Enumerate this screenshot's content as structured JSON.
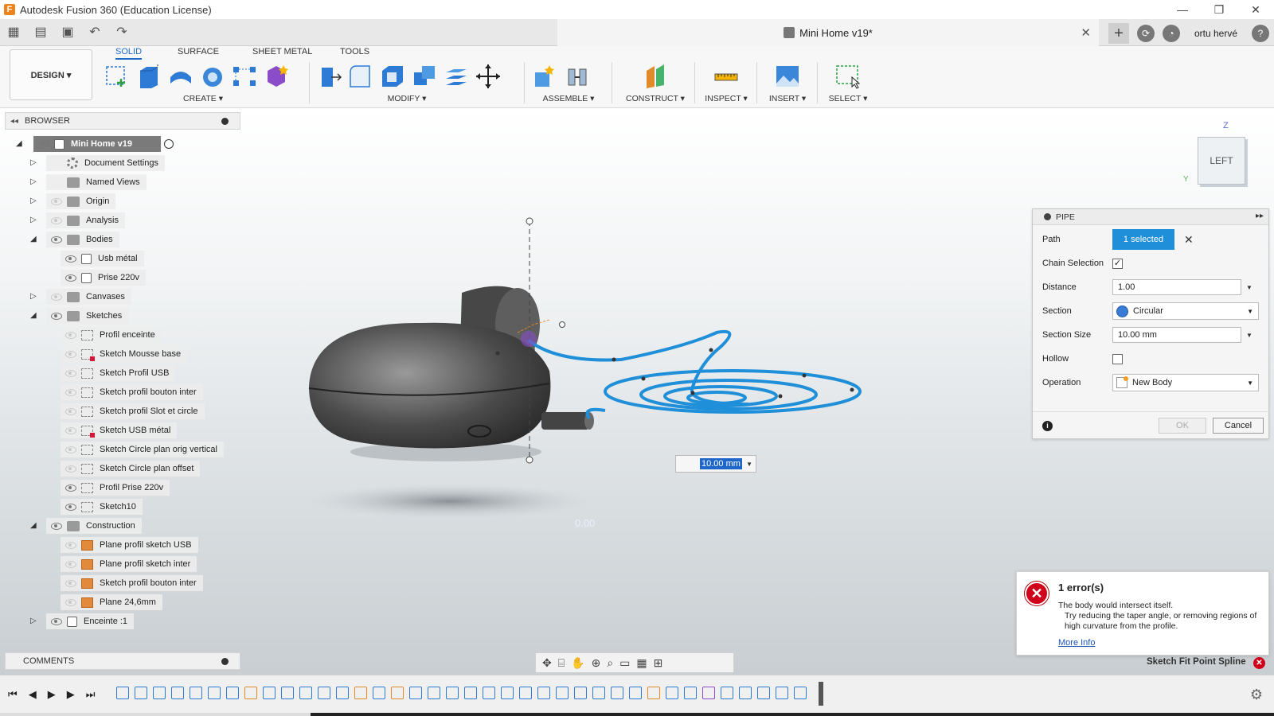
{
  "window": {
    "app_title": "Autodesk Fusion 360 (Education License)",
    "app_icon_letter": "F",
    "minimize": "—",
    "restore": "❐",
    "close": "✕"
  },
  "tabbar": {
    "document_title": "Mini Home v19*",
    "close_glyph": "✕",
    "new_tab": "+",
    "user": "ortu hervé",
    "help": "?"
  },
  "ribbon": {
    "workspace": "DESIGN ▾",
    "tabs": [
      "SOLID",
      "SURFACE",
      "SHEET METAL",
      "TOOLS"
    ],
    "groups": {
      "create": "CREATE ▾",
      "modify": "MODIFY ▾",
      "assemble": "ASSEMBLE ▾",
      "construct": "CONSTRUCT ▾",
      "inspect": "INSPECT ▾",
      "insert": "INSERT ▾",
      "select": "SELECT ▾"
    }
  },
  "browser": {
    "title": "BROWSER",
    "collapse_glyph": "◂◂",
    "root": "Mini Home v19",
    "items": [
      {
        "label": "Document Settings"
      },
      {
        "label": "Named Views"
      },
      {
        "label": "Origin"
      },
      {
        "label": "Analysis"
      },
      {
        "label": "Bodies"
      },
      {
        "label": "Usb métal"
      },
      {
        "label": "Prise 220v"
      },
      {
        "label": "Canvases"
      },
      {
        "label": "Sketches"
      },
      {
        "label": "Profil enceinte"
      },
      {
        "label": "Sketch Mousse base"
      },
      {
        "label": "Sketch Profil USB"
      },
      {
        "label": "Sketch profil  bouton inter"
      },
      {
        "label": "Sketch profil Slot et circle"
      },
      {
        "label": "Sketch USB métal"
      },
      {
        "label": "Sketch Circle plan orig vertical"
      },
      {
        "label": "Sketch Circle plan offset"
      },
      {
        "label": "Profil Prise 220v"
      },
      {
        "label": "Sketch10"
      },
      {
        "label": "Construction"
      },
      {
        "label": "Plane profil sketch USB"
      },
      {
        "label": "Plane profil sketch inter"
      },
      {
        "label": "Sketch profil  bouton inter"
      },
      {
        "label": "Plane 24,6mm"
      },
      {
        "label": "Enceinte :1"
      }
    ]
  },
  "comments": {
    "title": "COMMENTS"
  },
  "pipe_dialog": {
    "title": "PIPE",
    "expand_glyph": "▸▸",
    "path_label": "Path",
    "path_value": "1 selected",
    "path_clear": "✕",
    "chain_label": "Chain Selection",
    "chain_checked": "✓",
    "distance_label": "Distance",
    "distance_value": "1.00",
    "section_label": "Section",
    "section_value": "Circular",
    "section_size_label": "Section Size",
    "section_size_value": "10.00 mm",
    "hollow_label": "Hollow",
    "operation_label": "Operation",
    "operation_value": "New Body",
    "ok": "OK",
    "cancel": "Cancel",
    "info": "i"
  },
  "error": {
    "title": "1 error(s)",
    "line1": "The body would intersect itself.",
    "line2": "Try reducing the taper angle, or removing regions of high curvature from the profile.",
    "link": "More Info"
  },
  "status": {
    "text": "Sketch Fit Point Spline",
    "close": "✕"
  },
  "viewcube": {
    "face": "LEFT",
    "z": "Z",
    "y": "Y"
  },
  "viewport": {
    "dist_value": "10.00 mm",
    "tube_label": "0.00"
  },
  "colors": {
    "accent": "#1b6ac9",
    "path_blue": "#1e8fd8",
    "error_red": "#d0021b"
  }
}
